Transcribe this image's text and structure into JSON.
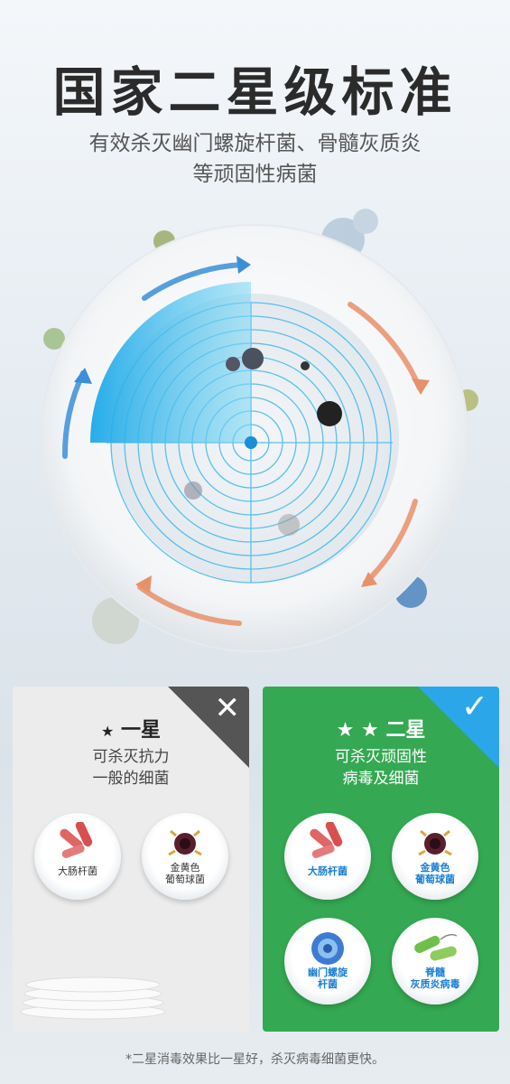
{
  "header": {
    "title": "国家二星级标准",
    "subtitle_line1": "有效杀灭幽门螺旋杆菌、骨髓灰质炎",
    "subtitle_line2": "等顽固性病菌"
  },
  "cards": {
    "one_star": {
      "stars": "★",
      "title": "一星",
      "desc_line1": "可杀灭抗力",
      "desc_line2": "一般的细菌",
      "corner_mark": "✕",
      "plates": [
        {
          "label_line1": "大肠杆菌",
          "label_line2": ""
        },
        {
          "label_line1": "金黄色",
          "label_line2": "葡萄球菌"
        }
      ]
    },
    "two_star": {
      "stars": "★ ★",
      "title": "二星",
      "desc_line1": "可杀灭顽固性",
      "desc_line2": "病毒及细菌",
      "corner_mark": "✓",
      "plates": [
        {
          "label_line1": "大肠杆菌",
          "label_line2": ""
        },
        {
          "label_line1": "金黄色",
          "label_line2": "葡萄球菌"
        },
        {
          "label_line1": "幽门螺旋",
          "label_line2": "杆菌"
        },
        {
          "label_line1": "脊髓",
          "label_line2": "灰质炎病毒"
        }
      ]
    }
  },
  "footnote": "*二星消毒效果比一星好，杀灭病毒细菌更快。",
  "colors": {
    "green": "#35a853",
    "blue_label": "#1a7fd4",
    "radar_blue": "#22b3ea",
    "arrow_orange": "#e8906a"
  }
}
